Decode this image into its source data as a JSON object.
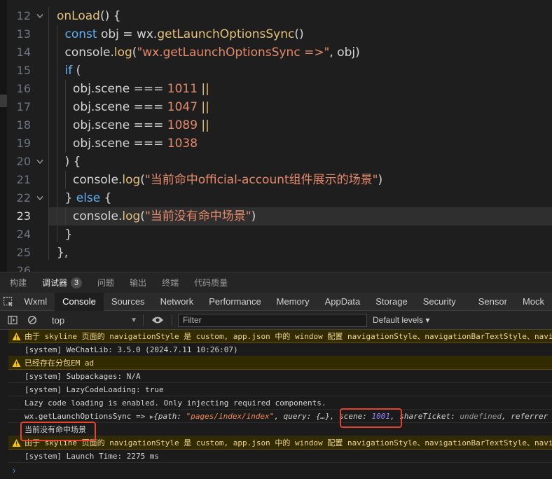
{
  "editor": {
    "lines": [
      {
        "n": "12",
        "fold": "v",
        "tokens": [
          [
            "fn",
            "onLoad"
          ],
          [
            "op",
            "() {"
          ]
        ],
        "indent": 0
      },
      {
        "n": "13",
        "tokens": [
          [
            "kw",
            "const"
          ],
          [
            "var",
            " obj "
          ],
          [
            "op",
            "= "
          ],
          [
            "var",
            "wx."
          ],
          [
            "fn",
            "getLaunchOptionsSync"
          ],
          [
            "op",
            "()"
          ]
        ],
        "indent": 1
      },
      {
        "n": "14",
        "tokens": [
          [
            "var",
            "console."
          ],
          [
            "fn",
            "log"
          ],
          [
            "op",
            "("
          ],
          [
            "str",
            "\"wx.getLaunchOptionsSync =>\""
          ],
          [
            "op",
            ", "
          ],
          [
            "var",
            "obj"
          ],
          [
            "op",
            ")"
          ]
        ],
        "indent": 1
      },
      {
        "n": "15",
        "tokens": [
          [
            "kw",
            "if"
          ],
          [
            "op",
            " ("
          ]
        ],
        "indent": 1
      },
      {
        "n": "16",
        "tokens": [
          [
            "var",
            "obj.scene "
          ],
          [
            "op",
            "=== "
          ],
          [
            "num",
            "1011"
          ],
          [
            "pipe",
            " ||"
          ]
        ],
        "indent": 2
      },
      {
        "n": "17",
        "tokens": [
          [
            "var",
            "obj.scene "
          ],
          [
            "op",
            "=== "
          ],
          [
            "num",
            "1047"
          ],
          [
            "pipe",
            " ||"
          ]
        ],
        "indent": 2
      },
      {
        "n": "18",
        "tokens": [
          [
            "var",
            "obj.scene "
          ],
          [
            "op",
            "=== "
          ],
          [
            "num",
            "1089"
          ],
          [
            "pipe",
            " ||"
          ]
        ],
        "indent": 2
      },
      {
        "n": "19",
        "tokens": [
          [
            "var",
            "obj.scene "
          ],
          [
            "op",
            "=== "
          ],
          [
            "num",
            "1038"
          ]
        ],
        "indent": 2
      },
      {
        "n": "20",
        "fold": "v",
        "tokens": [
          [
            "op",
            ") {"
          ]
        ],
        "indent": 1
      },
      {
        "n": "21",
        "tokens": [
          [
            "var",
            "console."
          ],
          [
            "fn",
            "log"
          ],
          [
            "op",
            "("
          ],
          [
            "str",
            "\"当前命中official-account组件展示的场景\""
          ],
          [
            "op",
            ")"
          ]
        ],
        "indent": 2
      },
      {
        "n": "22",
        "fold": "v",
        "tokens": [
          [
            "op",
            "} "
          ],
          [
            "kw",
            "else"
          ],
          [
            "op",
            " {"
          ]
        ],
        "indent": 1
      },
      {
        "n": "23",
        "active": true,
        "tokens": [
          [
            "var",
            "console."
          ],
          [
            "fn",
            "log"
          ],
          [
            "op",
            "("
          ],
          [
            "str",
            "\"当前没有命中场景\""
          ],
          [
            "op",
            ")"
          ]
        ],
        "indent": 2
      },
      {
        "n": "24",
        "tokens": [
          [
            "op",
            "}"
          ]
        ],
        "indent": 1
      },
      {
        "n": "25",
        "tokens": [
          [
            "op",
            "},"
          ]
        ],
        "indent": 0
      },
      {
        "n": "26",
        "tokens": [],
        "indent": 0
      }
    ]
  },
  "panel_tabs": [
    {
      "label": "构建",
      "active": false
    },
    {
      "label": "调试器",
      "active": true,
      "badge": "3"
    },
    {
      "label": "问题",
      "active": false
    },
    {
      "label": "输出",
      "active": false
    },
    {
      "label": "终端",
      "active": false
    },
    {
      "label": "代码质量",
      "active": false
    }
  ],
  "devtools_tabs": [
    {
      "label": "Wxml",
      "active": false
    },
    {
      "label": "Console",
      "active": true
    },
    {
      "label": "Sources",
      "active": false
    },
    {
      "label": "Network",
      "active": false
    },
    {
      "label": "Performance",
      "active": false
    },
    {
      "label": "Memory",
      "active": false
    },
    {
      "label": "AppData",
      "active": false
    },
    {
      "label": "Storage",
      "active": false
    },
    {
      "label": "Security",
      "active": false
    },
    {
      "label": "Sensor",
      "active": false
    },
    {
      "label": "Mock",
      "active": false
    }
  ],
  "console_bar": {
    "context": "top",
    "filter_placeholder": "Filter",
    "levels": "Default levels ▾"
  },
  "log": {
    "row1": "由于 skyline 页面的 navigationStyle 是 custom, app.json 中的 window 配置 navigationStyle、navigationBarTextStyle、navi",
    "row2": "[system] WeChatLib: 3.5.0 (2024.7.11 10:26:07)",
    "row3": "已经存在分包EM ad",
    "row4": "[system] Subpackages: N/A",
    "row5": "[system] LazyCodeLoading: true",
    "row6": "Lazy code loading is enabled. Only injecting required components.",
    "row7": {
      "prefix": "wx.getLaunchOptionsSync => ",
      "tri": "▶",
      "path_key": "{path: ",
      "path_val": "\"pages/index/index\"",
      "query": ", query: {…}, ",
      "scene_key": "scene: ",
      "scene_val": "1001",
      "comma": ", ",
      "share_key": "shareTicket: ",
      "share_val": "undefined",
      "ref": ", referrer"
    },
    "row8": "当前没有命中场景",
    "row9": "由于 skyline 页面的 navigationStyle 是 custom, app.json 中的 window 配置 navigationStyle、navigationBarTextStyle、navi",
    "row10": "[system] Launch Time: 2275 ms",
    "prompt": "›"
  }
}
